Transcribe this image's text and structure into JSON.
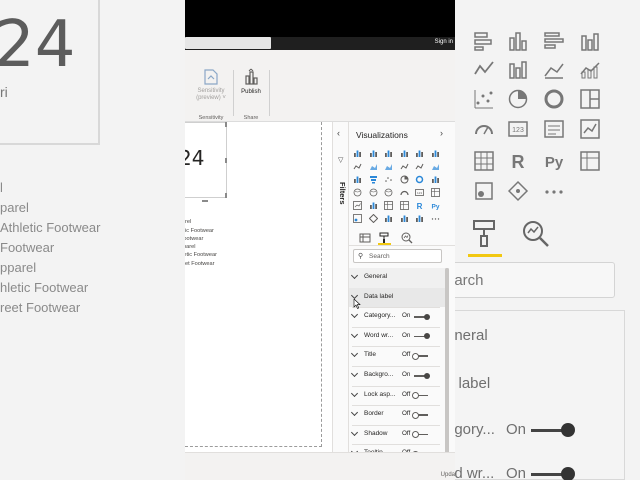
{
  "background": {
    "left": {
      "big_number": "24",
      "sub": "ri",
      "list": [
        "l",
        "parel",
        "Athletic Footwear",
        "Footwear",
        "pparel",
        "hletic Footwear",
        "reet Footwear"
      ]
    },
    "right": {
      "search": "earch",
      "rows": [
        {
          "label": "eneral",
          "state": ""
        },
        {
          "label": "a label",
          "state": ""
        },
        {
          "label": "egory...",
          "state": "On"
        },
        {
          "label": "nd wr...",
          "state": "On"
        }
      ]
    }
  },
  "app": {
    "titlebar": {
      "sign_in": "Sign in"
    },
    "ribbon": {
      "sensitivity": {
        "label1": "Sensitivity",
        "label2": "(preview) ˅",
        "group": "Sensitivity"
      },
      "publish": {
        "label": "Publish",
        "group": "Share"
      }
    },
    "canvas": {
      "card": {
        "value": "24",
        "label": "ri"
      },
      "slicer_items": [
        "y",
        "rel",
        "ic Footwear",
        "Footwear",
        "parel",
        "hletic Footwear",
        "reet Footwear"
      ]
    },
    "status": "Upda",
    "filters": {
      "label": "Filters"
    },
    "visualizations": {
      "title": "Visualizations",
      "search_placeholder": "Search",
      "format_rows": [
        {
          "name": "General",
          "state": "",
          "toggle": ""
        },
        {
          "name": "Data label",
          "state": "",
          "toggle": ""
        },
        {
          "name": "Category...",
          "state": "On",
          "toggle": "on"
        },
        {
          "name": "Word wr...",
          "state": "On",
          "toggle": "on"
        },
        {
          "name": "Title",
          "state": "Off",
          "toggle": "off"
        },
        {
          "name": "Backgro...",
          "state": "On",
          "toggle": "on"
        },
        {
          "name": "Lock asp...",
          "state": "Off",
          "toggle": "off"
        },
        {
          "name": "Border",
          "state": "Off",
          "toggle": "off"
        },
        {
          "name": "Shadow",
          "state": "Off",
          "toggle": "off"
        },
        {
          "name": "Tooltip",
          "state": "Off",
          "toggle": "off"
        }
      ]
    }
  },
  "colors": {
    "accent": "#f2c811",
    "dark": "#252423",
    "icon": "#605e5c",
    "ribbon_bg": "#f3f2f1"
  }
}
